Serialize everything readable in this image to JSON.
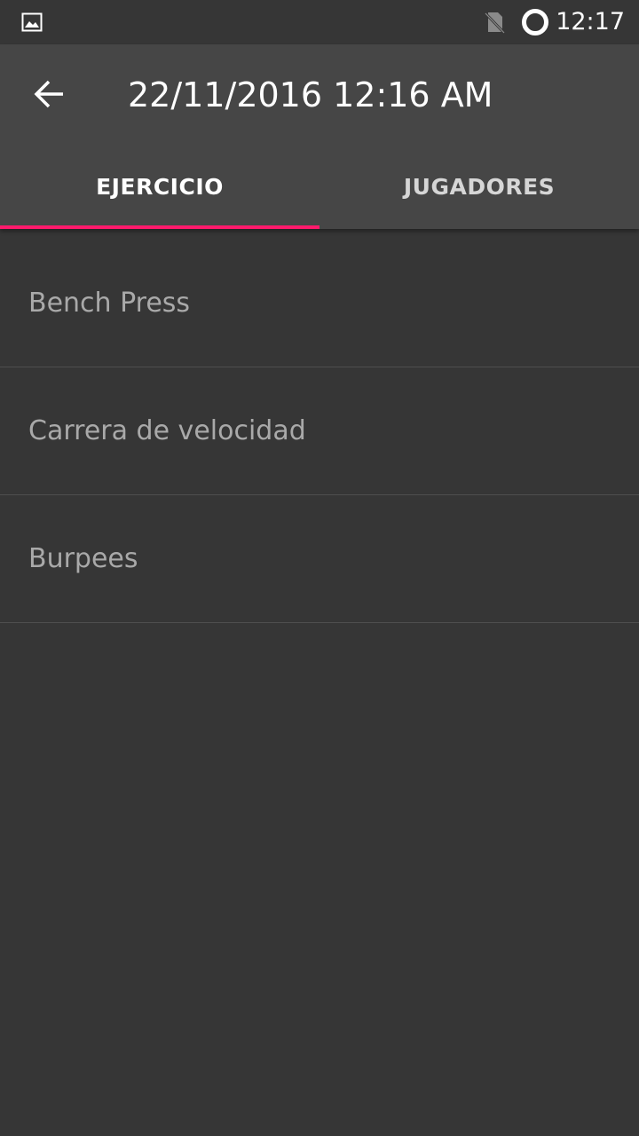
{
  "status_bar": {
    "time": "12:17",
    "icons": [
      "image-icon",
      "no-sim-icon",
      "battery-ring-icon"
    ]
  },
  "app_bar": {
    "back_icon": "arrow-back-icon",
    "title": "22/11/2016 12:16 AM"
  },
  "tabs": [
    {
      "label": "EJERCICIO",
      "selected": true
    },
    {
      "label": "JUGADORES",
      "selected": false
    }
  ],
  "colors": {
    "accent": "#ff1a6c",
    "app_bar": "#464646",
    "background": "#363636"
  },
  "exercises": [
    {
      "label": "Bench Press"
    },
    {
      "label": "Carrera de velocidad"
    },
    {
      "label": "Burpees"
    }
  ]
}
